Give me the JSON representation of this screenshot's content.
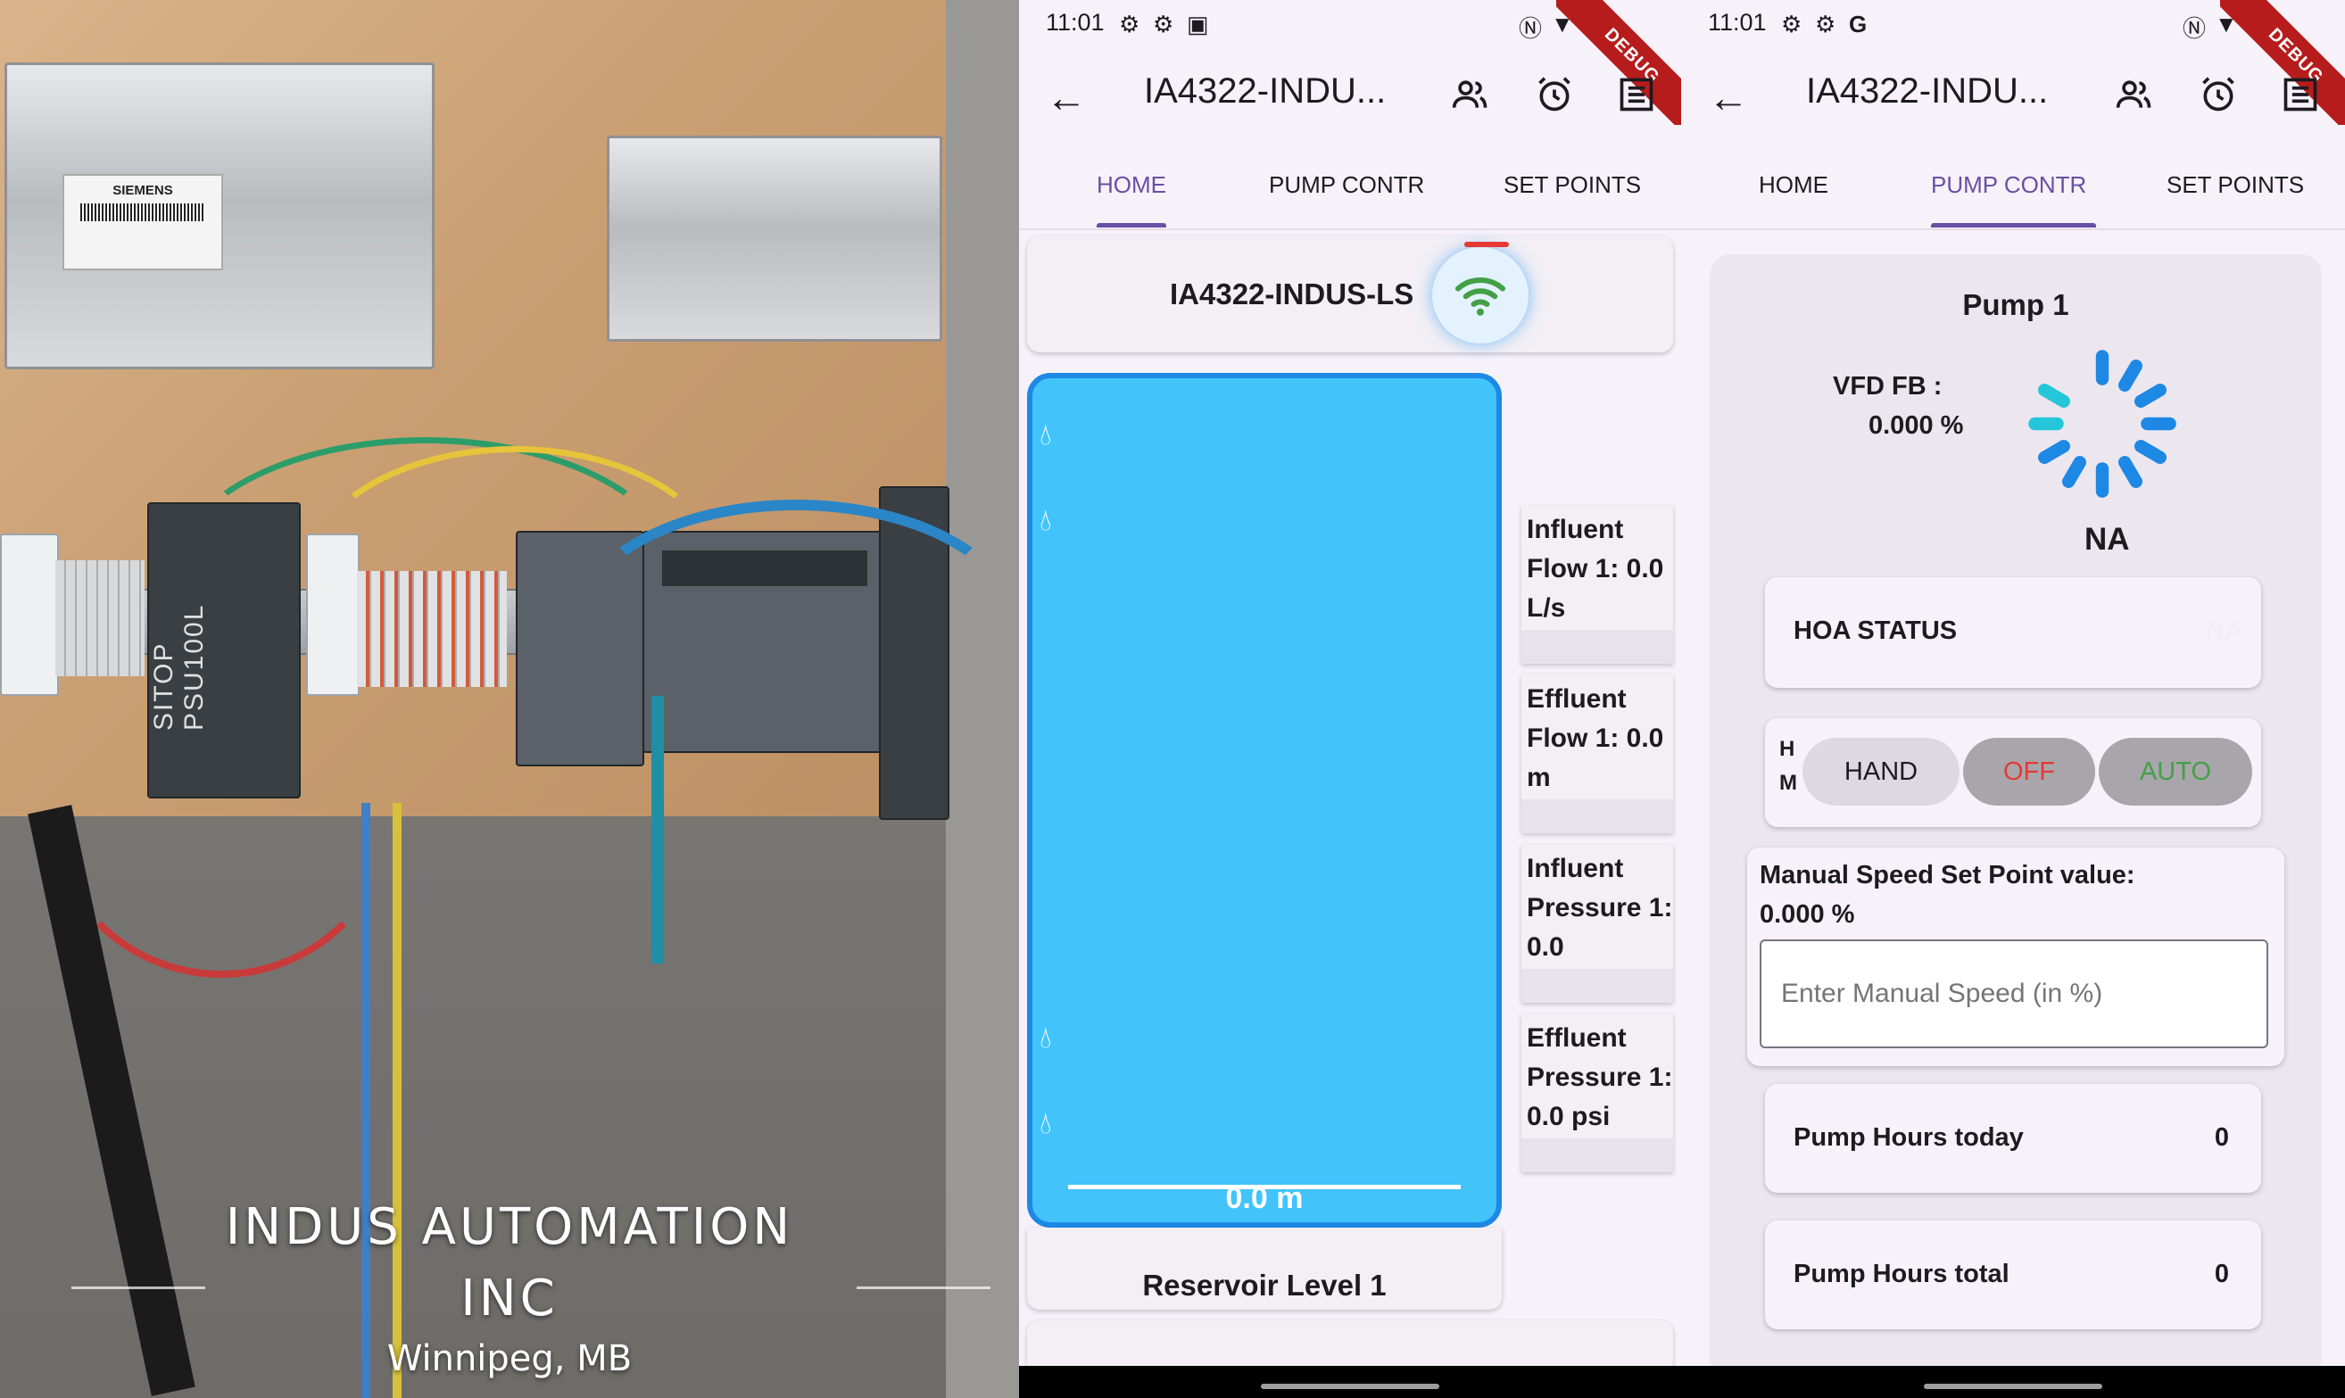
{
  "photo": {
    "brand_title": "INDUS AUTOMATION INC",
    "brand_line1": "INDUS AUTOMATION",
    "brand_line2": "INC",
    "location": "Winnipeg, MB",
    "psu_label": "SITOP PSU100L",
    "vendor_label": "SIEMENS"
  },
  "screen_home": {
    "status": {
      "time": "11:01",
      "debug": "DEBUG"
    },
    "appbar": {
      "title": "IA4322-INDU..."
    },
    "tabs": [
      {
        "label": "HOME",
        "active": true
      },
      {
        "label": "PUMP CONTR",
        "active": false
      },
      {
        "label": "SET POINTS",
        "active": false
      }
    ],
    "station_name": "IA4322-INDUS-LS",
    "tank": {
      "level_text": "0.0 m",
      "caption": "Reservoir Level 1"
    },
    "readings": [
      {
        "text": "Influent Flow 1: 0.0 L/s"
      },
      {
        "text": "Effluent Flow 1: 0.0 m"
      },
      {
        "text": "Influent Pressure 1: 0.0"
      },
      {
        "text": "Effluent Pressure 1: 0.0 psi"
      }
    ],
    "accent": "#6750a4",
    "wifi_color": "#43a047"
  },
  "screen_pump": {
    "status": {
      "time": "11:01",
      "debug": "DEBUG"
    },
    "appbar": {
      "title": "IA4322-INDU..."
    },
    "tabs": [
      {
        "label": "HOME",
        "active": false
      },
      {
        "label": "PUMP CONTR",
        "active": true
      },
      {
        "label": "SET POINTS",
        "active": false
      }
    ],
    "pump": {
      "title": "Pump 1",
      "vfd_label": "VFD FB :",
      "vfd_value": "0.000 %",
      "state": "NA",
      "hoa_label": "HOA STATUS",
      "hoa_value": "NA",
      "hm_letters": "H\nM",
      "toggle": {
        "hand": "HAND",
        "off": "OFF",
        "auto": "AUTO"
      },
      "manual_label": "Manual Speed Set Point value:",
      "manual_value": "0.000 %",
      "manual_placeholder": "Enter Manual Speed (in %)",
      "hours_today_label": "Pump Hours today",
      "hours_today_value": "0",
      "hours_total_label": "Pump Hours total",
      "hours_total_value": "0"
    },
    "colors": {
      "off": "#e53935",
      "auto": "#43a047",
      "spinner": "#1e88e5",
      "spinner_alt": "#26c6da"
    }
  }
}
